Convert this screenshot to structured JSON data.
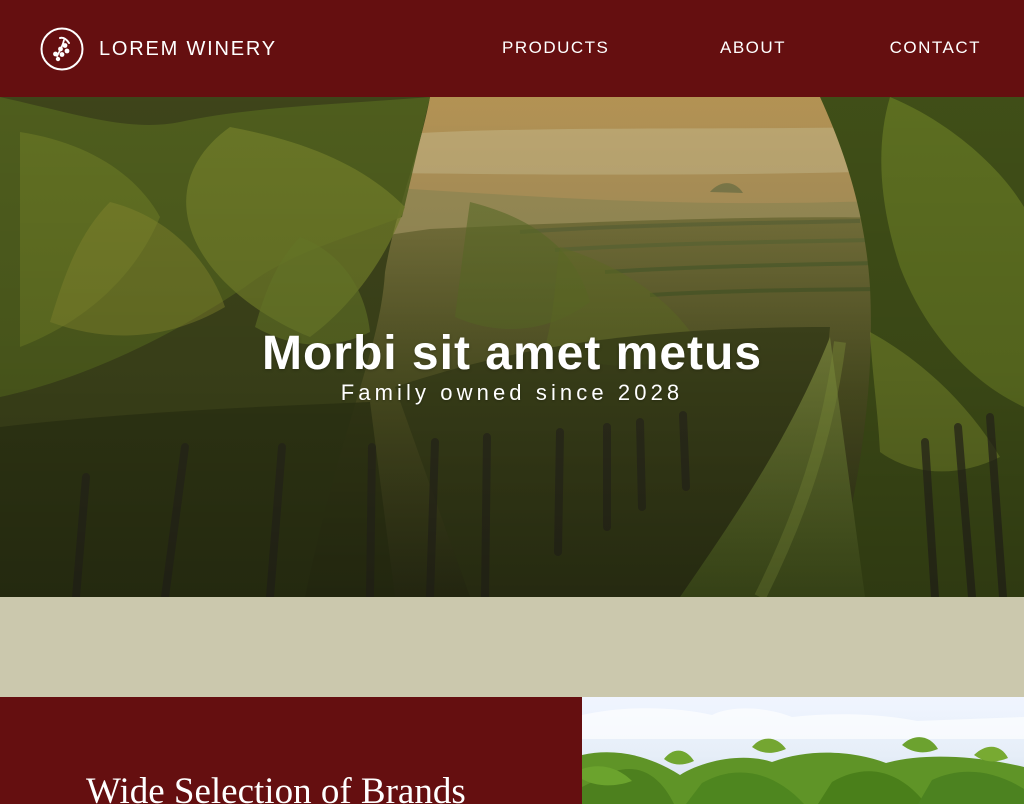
{
  "header": {
    "brand_name": "LOREM WINERY",
    "logo_icon": "grape-cluster-icon",
    "nav": {
      "products": "PRODUCTS",
      "about": "ABOUT",
      "contact": "CONTACT"
    }
  },
  "hero": {
    "title": "Morbi sit amet metus",
    "subtitle": "Family owned since 2028"
  },
  "feature": {
    "heading": "Wide Selection of Brands"
  },
  "colors": {
    "brand_red": "#650f10",
    "band_beige": "#cbc8ad",
    "text_white": "#ffffff"
  }
}
